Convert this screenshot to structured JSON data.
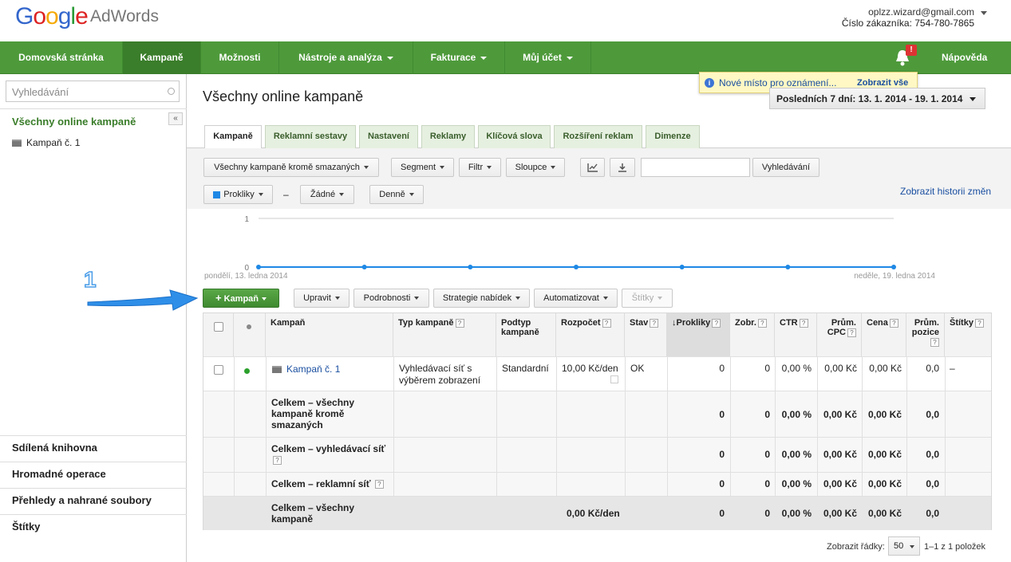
{
  "header": {
    "logo_text": "Google",
    "product": "AdWords",
    "account_email": "oplzz.wizard@gmail.com",
    "customer_id": "Číslo zákazníka: 754-780-7865"
  },
  "nav": {
    "items": [
      {
        "label": "Domovská stránka",
        "dropdown": false
      },
      {
        "label": "Kampaně",
        "dropdown": false,
        "active": true
      },
      {
        "label": "Možnosti",
        "dropdown": false
      },
      {
        "label": "Nástroje a analýza",
        "dropdown": true
      },
      {
        "label": "Fakturace",
        "dropdown": true
      },
      {
        "label": "Můj účet",
        "dropdown": true
      }
    ],
    "notification_badge": "!",
    "help": "Nápověda"
  },
  "notification": {
    "text": "Nové místo pro oznámení...",
    "link": "Zobrazit vše"
  },
  "sidebar": {
    "search_placeholder": "Vyhledávání",
    "all_campaigns": "Všechny online kampaně",
    "collapse": "«",
    "campaign": "Kampaň č. 1",
    "bottom": [
      "Sdílená knihovna",
      "Hromadné operace",
      "Přehledy a nahrané soubory",
      "Štítky"
    ]
  },
  "main": {
    "title": "Všechny online kampaně",
    "date_range": "Posledních 7 dní: 13. 1. 2014 - 19. 1. 2014",
    "tabs": [
      "Kampaně",
      "Reklamní sestavy",
      "Nastavení",
      "Reklamy",
      "Klíčová slova",
      "Rozšíření reklam",
      "Dimenze"
    ],
    "toolbar": {
      "filter_all": "Všechny kampaně kromě smazaných",
      "segment": "Segment",
      "filter": "Filtr",
      "columns": "Sloupce",
      "search_button": "Vyhledávání",
      "metric1": "Prokliky",
      "dash": "–",
      "metric2": "Žádné",
      "period": "Denně",
      "history_link": "Zobrazit historii změn"
    },
    "chart_labels": {
      "y_top": "1",
      "y_zero": "0",
      "x_start": "pondělí, 13. ledna 2014",
      "x_end": "neděle, 19. ledna 2014"
    },
    "action_bar": {
      "add": "Kampaň",
      "edit": "Upravit",
      "details": "Podrobnosti",
      "bid_strategy": "Strategie nabídek",
      "automate": "Automatizovat",
      "labels": "Štítky"
    },
    "callout": "1",
    "table": {
      "headers": {
        "campaign": "Kampaň",
        "type": "Typ kampaně",
        "subtype": "Podtyp kampaně",
        "budget": "Rozpočet",
        "status": "Stav",
        "clicks": "Prokliky",
        "impr": "Zobr.",
        "ctr": "CTR",
        "avg_cpc": "Prům. CPC",
        "cost": "Cena",
        "avg_pos": "Prům. pozice",
        "labels": "Štítky"
      },
      "row": {
        "campaign": "Kampaň č. 1",
        "type": "Vyhledávací síť s výběrem zobrazení",
        "subtype": "Standardní",
        "budget": "10,00 Kč/den",
        "status": "OK",
        "clicks": "0",
        "impr": "0",
        "ctr": "0,00 %",
        "avg_cpc": "0,00 Kč",
        "cost": "0,00 Kč",
        "avg_pos": "0,0",
        "labels": "–"
      },
      "totals": [
        {
          "label": "Celkem – všechny kampaně kromě smazaných",
          "clicks": "0",
          "impr": "0",
          "ctr": "0,00 %",
          "avg_cpc": "0,00 Kč",
          "cost": "0,00 Kč",
          "avg_pos": "0,0"
        },
        {
          "label": "Celkem – vyhledávací síť",
          "clicks": "0",
          "impr": "0",
          "ctr": "0,00 %",
          "avg_cpc": "0,00 Kč",
          "cost": "0,00 Kč",
          "avg_pos": "0,0"
        },
        {
          "label": "Celkem – reklamní síť",
          "clicks": "0",
          "impr": "0",
          "ctr": "0,00 %",
          "avg_cpc": "0,00 Kč",
          "cost": "0,00 Kč",
          "avg_pos": "0,0"
        },
        {
          "label": "Celkem – všechny kampaně",
          "budget": "0,00 Kč/den",
          "clicks": "0",
          "impr": "0",
          "ctr": "0,00 %",
          "avg_cpc": "0,00 Kč",
          "cost": "0,00 Kč",
          "avg_pos": "0,0"
        }
      ]
    },
    "footer": {
      "rows_label": "Zobrazit řádky:",
      "rows_value": "50",
      "count": "1–1 z 1 položek"
    }
  },
  "colors": {
    "nav_green": "#4e9a3b",
    "link_blue": "#1a4fa0",
    "series_blue": "#1e88e5",
    "status_green": "#2ca02c"
  },
  "chart_data": {
    "type": "line",
    "x": [
      "13. 1. 2014",
      "14. 1. 2014",
      "15. 1. 2014",
      "16. 1. 2014",
      "17. 1. 2014",
      "18. 1. 2014",
      "19. 1. 2014"
    ],
    "series": [
      {
        "name": "Prokliky",
        "values": [
          0,
          0,
          0,
          0,
          0,
          0,
          0
        ]
      }
    ],
    "ylim": [
      0,
      1
    ]
  }
}
